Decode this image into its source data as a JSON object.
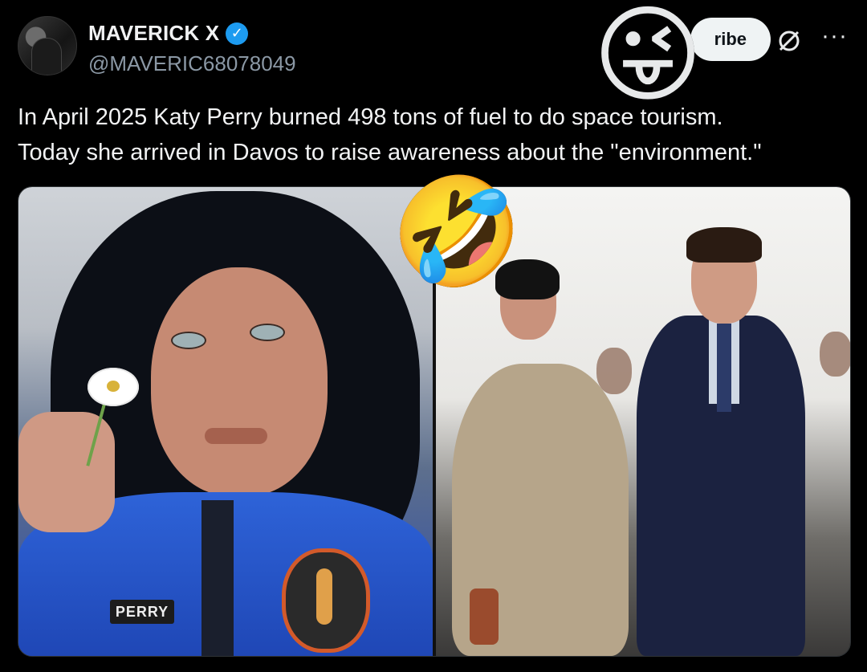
{
  "post": {
    "author": {
      "display_name": "MAVERICK X",
      "handle": "@MAVERIC68078049",
      "verified_icon": "✓"
    },
    "actions": {
      "subscribe_label": "ribe",
      "more_label": "···"
    },
    "text_line1": "In April 2025 Katy Perry burned 498 tons of fuel to do space tourism.",
    "text_line2": "Today she arrived in Davos to raise awareness about the \"environment.\"",
    "media": {
      "left_nametag": "PERRY"
    }
  },
  "overlay": {
    "emoji_top": "😜",
    "emoji_mid": "🤣"
  },
  "colors": {
    "verified_blue": "#1d9bf0",
    "background": "#000000",
    "handle_gray": "#8b98a5"
  }
}
